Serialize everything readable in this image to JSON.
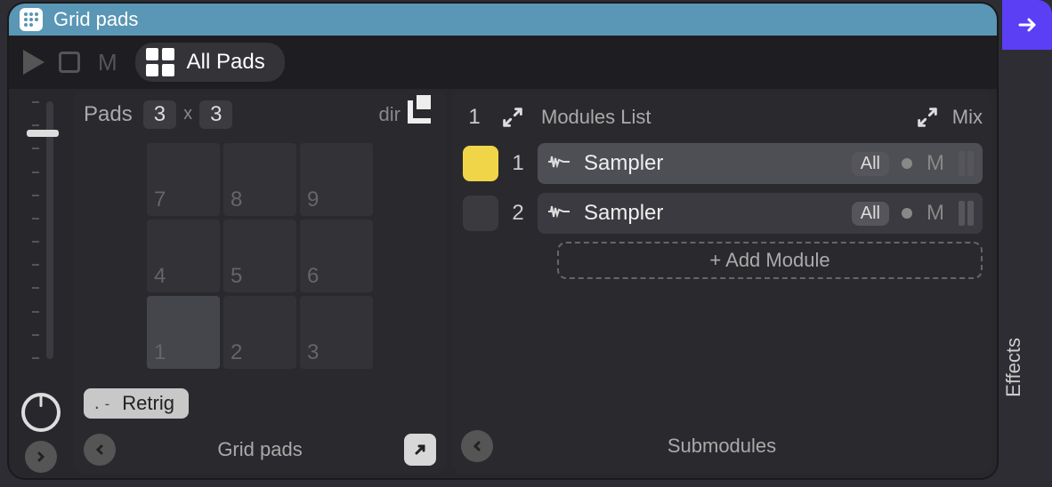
{
  "title": "Grid pads",
  "transport": {
    "mode_letter": "M",
    "all_pads_label": "All Pads"
  },
  "pads_config": {
    "label": "Pads",
    "cols": "3",
    "rows": "3",
    "dir_label": "dir"
  },
  "pads_grid": {
    "numbers": [
      "7",
      "8",
      "9",
      "4",
      "5",
      "6",
      "1",
      "2",
      "3"
    ],
    "selected_index": 6,
    "retrig_label": "Retrig"
  },
  "left_panel": {
    "footer_title": "Grid pads"
  },
  "modules": {
    "header_index": "1",
    "list_label": "Modules List",
    "mix_label": "Mix",
    "add_label": "+ Add Module",
    "rows": [
      {
        "index": "1",
        "name": "Sampler",
        "scope": "All",
        "mute": "M",
        "color": "yellow",
        "selected": true
      },
      {
        "index": "2",
        "name": "Sampler",
        "scope": "All",
        "mute": "M",
        "color": "dark",
        "selected": false
      }
    ],
    "footer_title": "Submodules"
  },
  "side": {
    "effects_label": "Effects"
  }
}
